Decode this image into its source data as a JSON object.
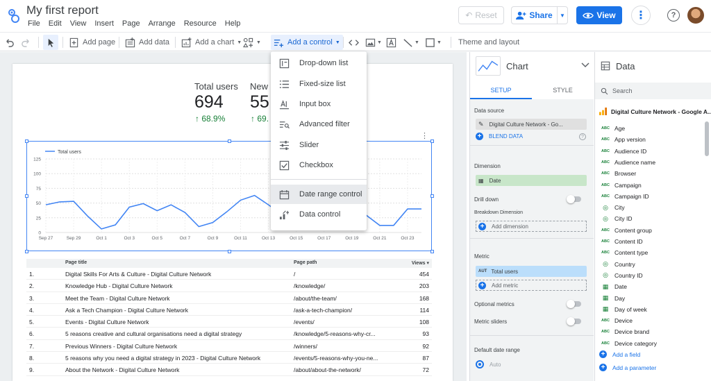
{
  "header": {
    "title": "My first report",
    "menu": [
      "File",
      "Edit",
      "View",
      "Insert",
      "Page",
      "Arrange",
      "Resource",
      "Help"
    ],
    "reset": "Reset",
    "share": "Share",
    "view": "View"
  },
  "toolbar": {
    "add_page": "Add page",
    "add_data": "Add data",
    "add_chart": "Add a chart",
    "add_control": "Add a control",
    "theme": "Theme and layout"
  },
  "control_menu": [
    {
      "label": "Drop-down list",
      "icon": "dropdown-list-icon"
    },
    {
      "label": "Fixed-size list",
      "icon": "list-icon"
    },
    {
      "label": "Input box",
      "icon": "input-box-icon"
    },
    {
      "label": "Advanced filter",
      "icon": "advanced-filter-icon"
    },
    {
      "label": "Slider",
      "icon": "slider-icon"
    },
    {
      "label": "Checkbox",
      "icon": "checkbox-icon"
    },
    {
      "label": "Date range control",
      "icon": "calendar-icon"
    },
    {
      "label": "Data control",
      "icon": "data-control-icon"
    }
  ],
  "scorecards": [
    {
      "label": "Total users",
      "value": "694",
      "delta": "68.9%"
    },
    {
      "label": "New u",
      "value": "55",
      "delta": "69."
    }
  ],
  "chart_data": {
    "type": "line",
    "legend": "Total users",
    "x": [
      "Sep 27",
      "Sep 28",
      "Sep 29",
      "Sep 30",
      "Oct 1",
      "Oct 2",
      "Oct 3",
      "Oct 4",
      "Oct 5",
      "Oct 6",
      "Oct 7",
      "Oct 8",
      "Oct 9",
      "Oct 10",
      "Oct 11",
      "Oct 12",
      "Oct 13",
      "Oct 14",
      "Oct 15",
      "Oct 16",
      "Oct 17",
      "Oct 18",
      "Oct 19",
      "Oct 20",
      "Oct 21",
      "Oct 22",
      "Oct 23",
      "Oct 24"
    ],
    "xticks": [
      "Sep 27",
      "Sep 29",
      "Oct 1",
      "Oct 3",
      "Oct 5",
      "Oct 7",
      "Oct 9",
      "Oct 11",
      "Oct 13",
      "Oct 15",
      "Oct 17",
      "Oct 19",
      "Oct 21",
      "Oct 23"
    ],
    "series": [
      {
        "name": "Total users",
        "values": [
          47,
          52,
          53,
          28,
          6,
          13,
          43,
          49,
          37,
          47,
          34,
          10,
          17,
          35,
          55,
          63,
          47,
          30,
          18,
          12,
          22,
          40,
          53,
          30,
          12,
          12,
          40,
          0
        ]
      }
    ],
    "ylim": [
      0,
      125
    ],
    "yticks": [
      0,
      25,
      50,
      75,
      100,
      125
    ],
    "color": "#4285f4"
  },
  "table": {
    "headers": [
      "Page title",
      "Page path",
      "Views"
    ],
    "rows": [
      [
        "1.",
        "Digital Skills For Arts & Culture - Digital Culture Network",
        "/",
        "454"
      ],
      [
        "2.",
        "Knowledge Hub - Digital Culture Network",
        "/knowledge/",
        "203"
      ],
      [
        "3.",
        "Meet the Team - Digital Culture Network",
        "/about/the-team/",
        "168"
      ],
      [
        "4.",
        "Ask a Tech Champion - Digital Culture Network",
        "/ask-a-tech-champion/",
        "114"
      ],
      [
        "5.",
        "Events - Digital Culture Network",
        "/events/",
        "108"
      ],
      [
        "6.",
        "5 reasons creative and cultural organisations need a digital strategy",
        "/knowledge/5-reasons-why-cr...",
        "93"
      ],
      [
        "7.",
        "Previous Winners - Digital Culture Network",
        "/winners/",
        "92"
      ],
      [
        "8.",
        "5 reasons why you need a digital strategy in 2023 - Digital Culture Network",
        "/events/5-reasons-why-you-ne...",
        "87"
      ],
      [
        "9.",
        "About the Network - Digital Culture Network",
        "/about/about-the-network/",
        "72"
      ]
    ]
  },
  "chart_panel": {
    "title": "Chart",
    "tab_setup": "SETUP",
    "tab_style": "STYLE",
    "data_source_label": "Data source",
    "data_source": "Digital Culture Network - Go...",
    "blend": "BLEND DATA",
    "dimension_label": "Dimension",
    "dimension": "Date",
    "drill_down": "Drill down",
    "breakdown": "Breakdown Dimension",
    "add_dimension": "Add dimension",
    "metric_label": "Metric",
    "metric_badge": "AUT",
    "metric": "Total users",
    "add_metric": "Add metric",
    "optional_metrics": "Optional metrics",
    "metric_sliders": "Metric sliders",
    "default_date": "Default date range",
    "auto": "Auto"
  },
  "data_panel": {
    "title": "Data",
    "search_placeholder": "Search",
    "source": "Digital Culture Network - Google A...",
    "fields": [
      {
        "name": "Age",
        "type": "abc"
      },
      {
        "name": "App version",
        "type": "abc"
      },
      {
        "name": "Audience ID",
        "type": "abc"
      },
      {
        "name": "Audience name",
        "type": "abc"
      },
      {
        "name": "Browser",
        "type": "abc"
      },
      {
        "name": "Campaign",
        "type": "abc"
      },
      {
        "name": "Campaign ID",
        "type": "abc"
      },
      {
        "name": "City",
        "type": "geo"
      },
      {
        "name": "City ID",
        "type": "geo"
      },
      {
        "name": "Content group",
        "type": "abc"
      },
      {
        "name": "Content ID",
        "type": "abc"
      },
      {
        "name": "Content type",
        "type": "abc"
      },
      {
        "name": "Country",
        "type": "geo"
      },
      {
        "name": "Country ID",
        "type": "geo"
      },
      {
        "name": "Date",
        "type": "date"
      },
      {
        "name": "Day",
        "type": "date"
      },
      {
        "name": "Day of week",
        "type": "date"
      },
      {
        "name": "Device",
        "type": "abc"
      },
      {
        "name": "Device brand",
        "type": "abc"
      },
      {
        "name": "Device category",
        "type": "abc"
      }
    ],
    "add_field": "Add a field",
    "add_parameter": "Add a parameter"
  }
}
